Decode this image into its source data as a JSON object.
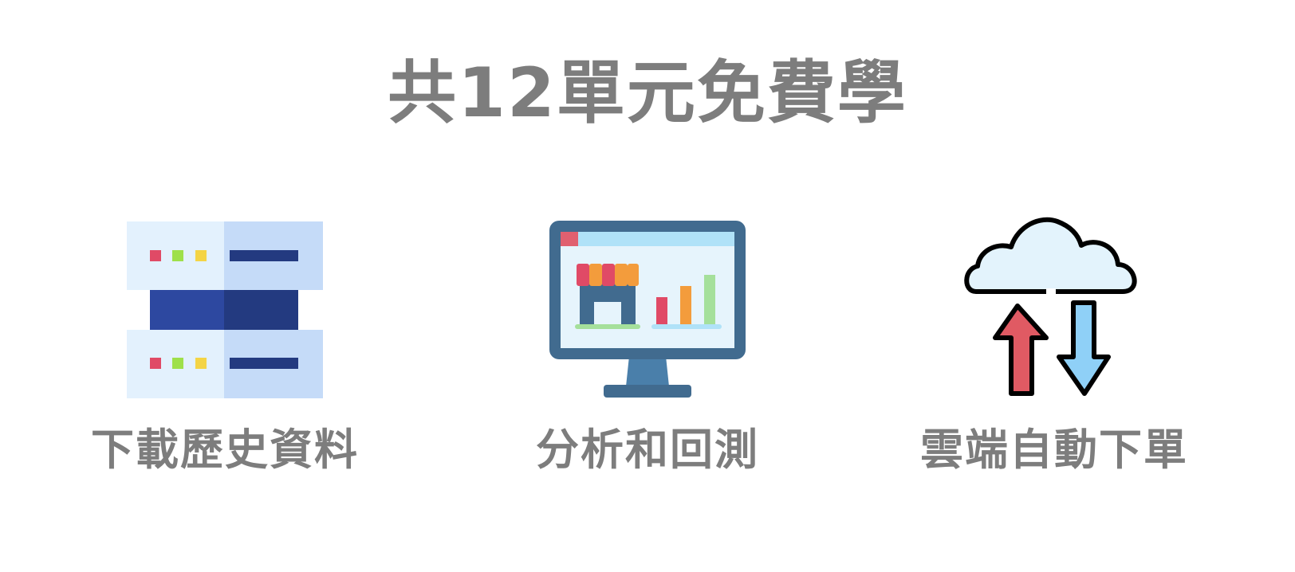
{
  "headline": "共12單元免費學",
  "features": [
    {
      "icon": "server-database-icon",
      "label": "下載歷史資料"
    },
    {
      "icon": "monitor-chart-icon",
      "label": "分析和回測"
    },
    {
      "icon": "cloud-sync-icon",
      "label": "雲端自動下單"
    }
  ],
  "colors": {
    "text_gray": "#7d7d7d",
    "server_light": "#e3f1fd",
    "server_panel": "#c5dbf8",
    "server_dark": "#233a80",
    "monitor_frame": "#416b8f",
    "arrow_red": "#e05a63",
    "arrow_blue": "#8fd0f7"
  }
}
